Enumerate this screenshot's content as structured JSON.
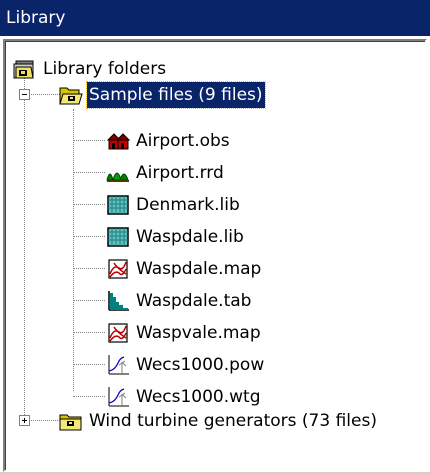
{
  "window": {
    "title": "Library"
  },
  "tree": {
    "root": {
      "label": "Library folders",
      "icon": "library-folder-icon"
    },
    "sample_folder": {
      "label": "Sample files (9 files)",
      "icon": "open-folder-icon",
      "expanded": true
    },
    "files": [
      {
        "label": "Airport.obs",
        "icon": "obstacles-file-icon"
      },
      {
        "label": "Airport.rrd",
        "icon": "roughness-file-icon"
      },
      {
        "label": "Denmark.lib",
        "icon": "wind-atlas-file-icon"
      },
      {
        "label": "Waspdale.lib",
        "icon": "wind-atlas-file-icon"
      },
      {
        "label": "Waspdale.map",
        "icon": "map-file-icon"
      },
      {
        "label": "Waspdale.tab",
        "icon": "observed-wind-climate-icon"
      },
      {
        "label": "Waspvale.map",
        "icon": "map-file-icon"
      },
      {
        "label": "Wecs1000.pow",
        "icon": "power-curve-file-icon"
      },
      {
        "label": "Wecs1000.wtg",
        "icon": "wind-turbine-file-icon"
      }
    ],
    "wtg_folder": {
      "label": "Wind turbine generators (73 files)",
      "icon": "closed-folder-icon",
      "expanded": false
    }
  },
  "colors": {
    "titlebar": "#0a246a",
    "selection": "#0a246a",
    "folder": "#c8b400"
  }
}
